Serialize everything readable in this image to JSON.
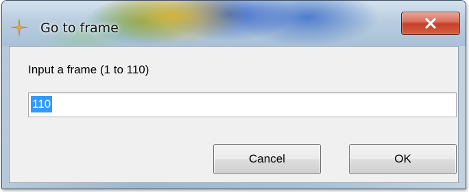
{
  "window": {
    "title": "Go to frame",
    "icon": "crosshair-star-icon",
    "close_icon": "close-icon"
  },
  "dialog": {
    "prompt": "Input a frame (1 to 110)",
    "frame_input_value": "110",
    "frame_input_selected": true,
    "cancel_label": "Cancel",
    "ok_label": "OK"
  },
  "colors": {
    "selection": "#3399ff",
    "close_button": "#c6402a",
    "client_background": "#f0f0f0"
  }
}
